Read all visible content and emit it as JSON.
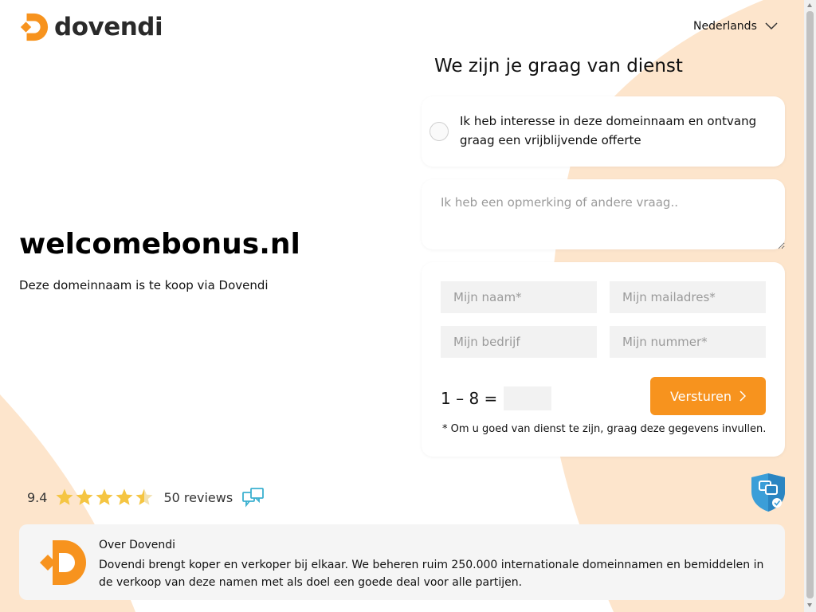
{
  "brand": {
    "name": "dovendi",
    "accent": "#f7931e",
    "peach": "#fde5cc"
  },
  "header": {
    "language": "Nederlands"
  },
  "hero": {
    "domain": "welcomebonus.nl",
    "subtitle": "Deze domeinnaam is te koop via Dovendi"
  },
  "form": {
    "heading": "We zijn je graag van dienst",
    "interest_option": "Ik heb interesse in deze domeinnaam en ontvang graag een vrijblijvende offerte",
    "interest_checked": false,
    "remark_placeholder": "Ik heb een opmerking of andere vraag..",
    "name_placeholder": "Mijn naam*",
    "email_placeholder": "Mijn mailadres*",
    "company_placeholder": "Mijn bedrijf",
    "phone_placeholder": "Mijn nummer*",
    "captcha_question": "1 – 8 =",
    "captcha_value": "",
    "submit_label": "Versturen",
    "note": "* Om u goed van dienst te zijn, graag deze gegevens invullen."
  },
  "rating": {
    "score": "9.4",
    "stars": 4.5,
    "reviews": "50 reviews",
    "star_color": "#f5c542"
  },
  "about": {
    "title": "Over Dovendi",
    "text": "Dovendi brengt koper en verkoper bij elkaar. We beheren ruim 250.000 internationale domeinnamen en bemiddelen in de verkoop van deze namen met als doel een goede deal voor alle partijen."
  },
  "icons": {
    "logo": "dovendi-logo-icon",
    "language_chevron": "chevron-down-icon",
    "submit_chevron": "chevron-right-icon",
    "shield": "shield-chat-icon",
    "reviews": "chat-bubbles-icon"
  }
}
